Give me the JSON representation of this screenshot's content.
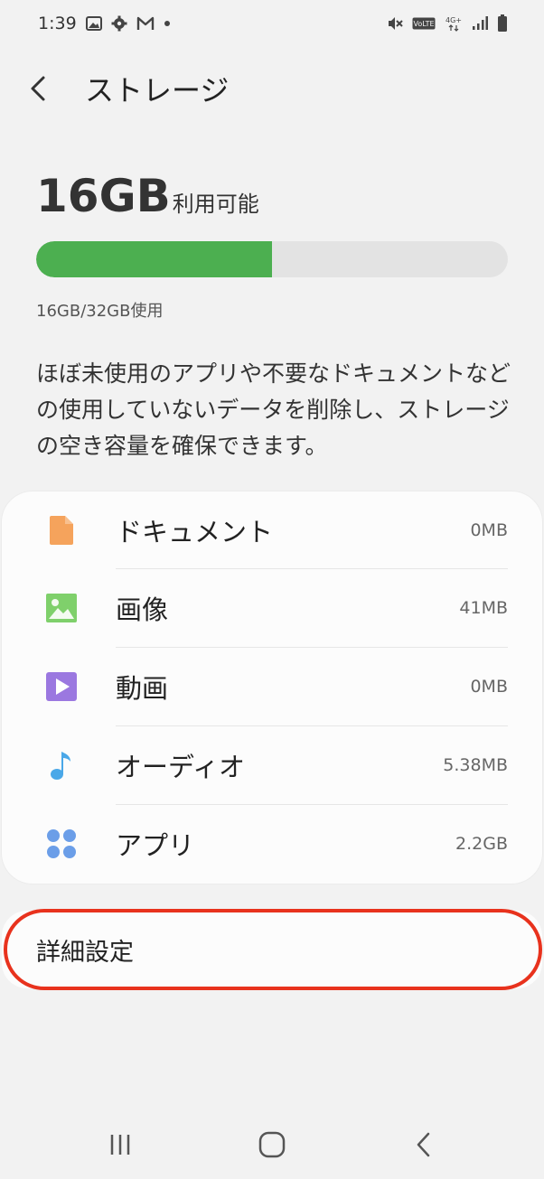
{
  "status_bar": {
    "time": "1:39",
    "left_icons": [
      "image-icon",
      "gear-icon",
      "gmail-icon",
      "dot-icon"
    ],
    "right_icons": [
      "mute-icon",
      "volte-icon",
      "4g-icon",
      "signal-icon",
      "battery-icon"
    ],
    "volte_label": "VoLTE",
    "network_label": "4G+"
  },
  "header": {
    "title": "ストレージ"
  },
  "storage": {
    "available_value": "16GB",
    "available_label": "利用可能",
    "used_text": "16GB/32GB使用",
    "used_fraction": 0.5,
    "bar_color": "#4caf50",
    "description": "ほぼ未使用のアプリや不要なドキュメントなどの使用していないデータを削除し、ストレージの空き容量を確保できます。"
  },
  "categories": [
    {
      "label": "ドキュメント",
      "size": "0MB",
      "icon": "document-icon",
      "color": "#f5a35c"
    },
    {
      "label": "画像",
      "size": "41MB",
      "icon": "image-icon",
      "color": "#7fd06b"
    },
    {
      "label": "動画",
      "size": "0MB",
      "icon": "video-icon",
      "color": "#9b78e0"
    },
    {
      "label": "オーディオ",
      "size": "5.38MB",
      "icon": "music-note-icon",
      "color": "#4aa8e8"
    },
    {
      "label": "アプリ",
      "size": "2.2GB",
      "icon": "apps-icon",
      "color": "#6b9ee8"
    }
  ],
  "advanced": {
    "label": "詳細設定",
    "highlight_color": "#e8321d"
  },
  "nav_bar": {
    "buttons": [
      "recent-apps-icon",
      "home-icon",
      "back-icon"
    ]
  }
}
